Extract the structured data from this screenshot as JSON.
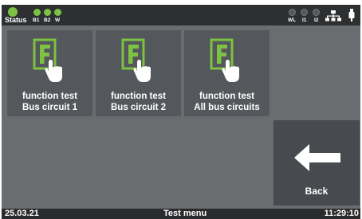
{
  "status_bar": {
    "status_label": "Status",
    "indicators_left": [
      "B1",
      "B2",
      "W"
    ],
    "indicators_right": [
      "WL",
      "I1",
      "I2"
    ],
    "network_icon": "network-icon",
    "usb_icon": "usb-icon"
  },
  "tiles": [
    {
      "icon": "f-touch-icon",
      "line1": "function test",
      "line2": "Bus circuit 1"
    },
    {
      "icon": "f-touch-icon",
      "line1": "function test",
      "line2": "Bus circuit 2"
    },
    {
      "icon": "f-touch-icon",
      "line1": "function test",
      "line2": "All bus circuits"
    }
  ],
  "back_button": {
    "label": "Back",
    "icon": "arrow-left-icon"
  },
  "footer": {
    "date": "25.03.21",
    "title": "Test menu",
    "time": "11:29:10"
  },
  "colors": {
    "accent": "#7dc242",
    "tile": "#54575b",
    "background": "#6a6c6f",
    "bar": "#2e2f31"
  }
}
